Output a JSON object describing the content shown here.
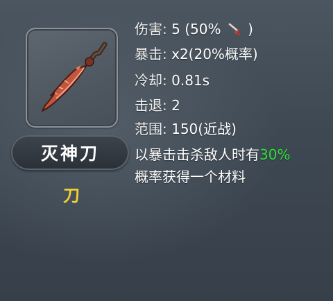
{
  "item": {
    "name": "灭神刀",
    "type": "刀",
    "icon": "red-broadsword-icon",
    "type_color": "#f3d232"
  },
  "stats": {
    "damage_label": "伤害:",
    "damage_value": "5 (50%",
    "damage_close": ")",
    "damage_icon": "small-sword-icon",
    "crit_label": "暴击:",
    "crit_value": "x2(20%概率)",
    "cooldown_label": "冷却:",
    "cooldown_value": "0.81s",
    "knockback_label": "击退:",
    "knockback_value": "2",
    "range_label": "范围:",
    "range_value": "150(近战)"
  },
  "description": {
    "part1": "以暴击击杀敌人时有",
    "highlight": "30%",
    "part2": "概率获得一个材料",
    "highlight_color": "#2fe33a"
  }
}
